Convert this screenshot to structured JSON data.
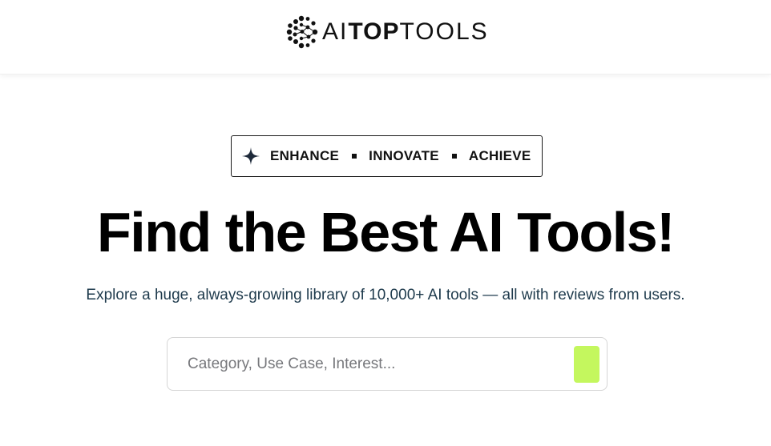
{
  "header": {
    "logo": {
      "text_light_1": "AI",
      "text_bold": "TOP",
      "text_light_2": "TOOLS"
    }
  },
  "hero": {
    "tagline": {
      "icon": "sparkle-icon",
      "words": [
        "ENHANCE",
        "INNOVATE",
        "ACHIEVE"
      ]
    },
    "title": "Find the Best AI Tools!",
    "subtitle": "Explore a huge, always-growing library of 10,000+ AI tools — all with reviews from users."
  },
  "search": {
    "placeholder": "Category, Use Case, Interest...",
    "value": "",
    "button_color": "#c4f75e"
  },
  "colors": {
    "accent": "#c4f75e",
    "subtitle_text": "#1e3a4c",
    "title_text": "#000000"
  }
}
